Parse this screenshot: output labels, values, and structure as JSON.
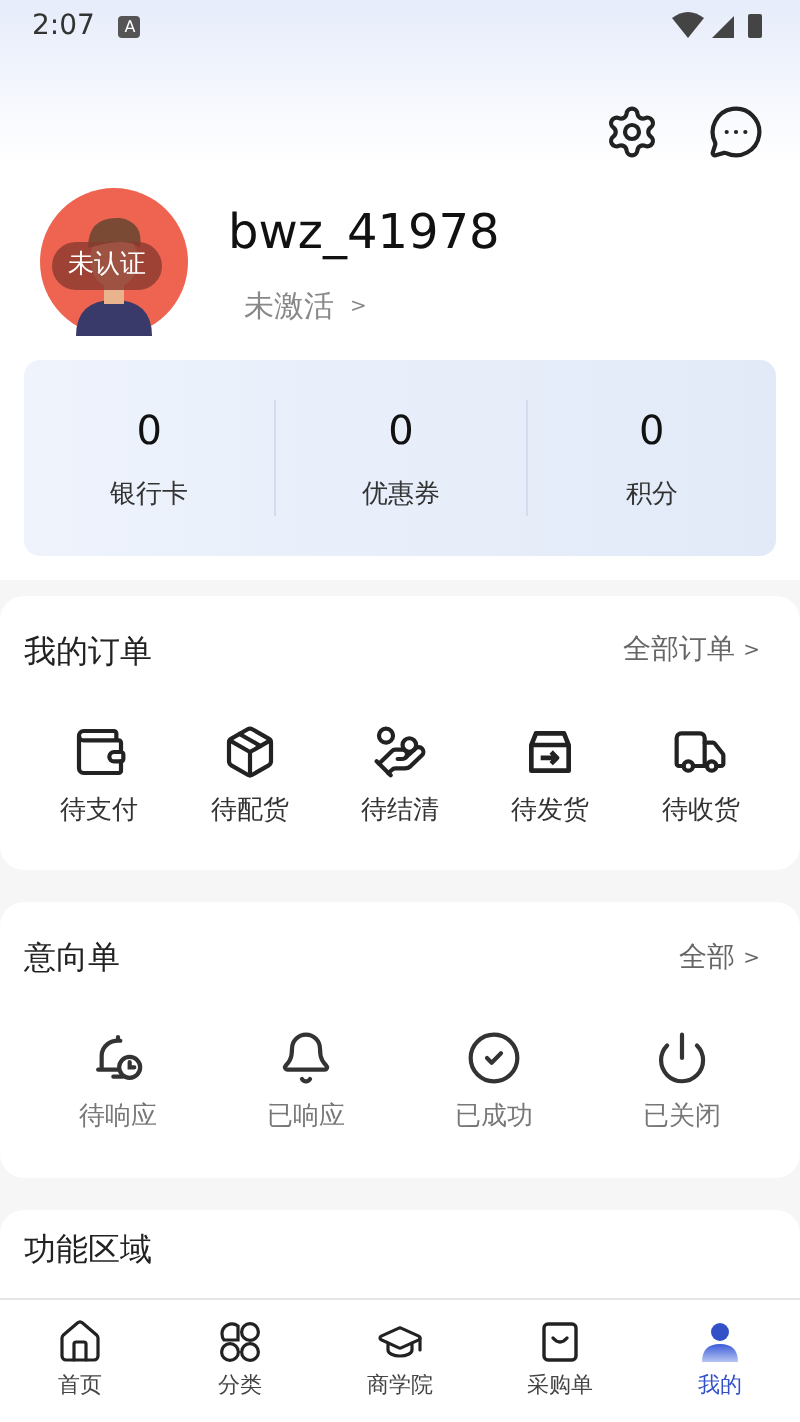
{
  "status_bar": {
    "time": "2:07",
    "notification": "A"
  },
  "profile": {
    "username": "bwz_41978",
    "badge": "未认证",
    "activation": "未激活",
    "activation_arrow": ">"
  },
  "stats": [
    {
      "value": "0",
      "label": "银行卡"
    },
    {
      "value": "0",
      "label": "优惠券"
    },
    {
      "value": "0",
      "label": "积分"
    }
  ],
  "orders": {
    "title": "我的订单",
    "link": "全部订单",
    "link_arrow": ">",
    "items": [
      "待支付",
      "待配货",
      "待结清",
      "待发货",
      "待收货"
    ]
  },
  "intents": {
    "title": "意向单",
    "link": "全部",
    "link_arrow": ">",
    "items": [
      "待响应",
      "已响应",
      "已成功",
      "已关闭"
    ]
  },
  "functions": {
    "title": "功能区域"
  },
  "tab_bar": [
    {
      "label": "首页",
      "selected": false
    },
    {
      "label": "分类",
      "selected": false
    },
    {
      "label": "商学院",
      "selected": false
    },
    {
      "label": "采购单",
      "selected": false
    },
    {
      "label": "我的",
      "selected": true
    }
  ]
}
